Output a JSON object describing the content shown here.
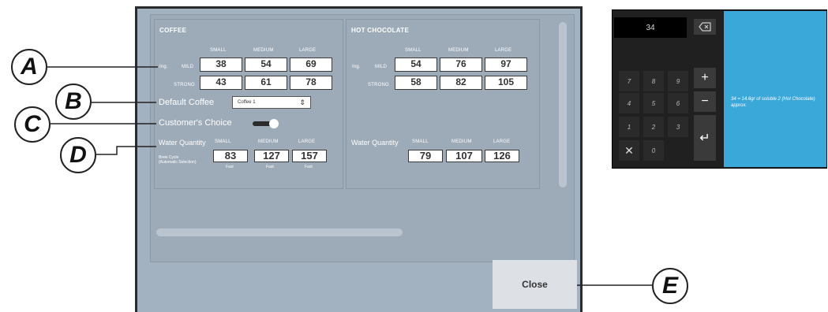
{
  "colors": {
    "panel": "#a3b2c0",
    "accent_blue": "#3aa8d8",
    "keypad_bg": "#202020"
  },
  "coffee": {
    "title": "COFFEE",
    "sizes": [
      "SMALL",
      "MEDIUM",
      "LARGE"
    ],
    "ing_label": "Ing.",
    "mild_label": "MILD",
    "strong_label": "STRONG",
    "mild": [
      "38",
      "54",
      "69"
    ],
    "strong": [
      "43",
      "61",
      "78"
    ],
    "default_label": "Default Coffee",
    "default_value": "Coffee 1",
    "customer_choice_label": "Customer's Choice",
    "customer_choice_on": true,
    "water_label": "Water Quantity",
    "water": [
      "83",
      "127",
      "157"
    ],
    "brew_label": "Brew Cycle\n(Automatic Selection)",
    "brew": [
      "Fast",
      "Fast",
      "Fast"
    ]
  },
  "hot_chocolate": {
    "title": "HOT CHOCOLATE",
    "sizes": [
      "SMALL",
      "MEDIUM",
      "LARGE"
    ],
    "ing_label": "Ing.",
    "mild_label": "MILD",
    "strong_label": "STRONG",
    "mild": [
      "54",
      "76",
      "97"
    ],
    "strong": [
      "58",
      "82",
      "105"
    ],
    "water_label": "Water Quantity",
    "water": [
      "79",
      "107",
      "126"
    ]
  },
  "close_label": "Close",
  "callouts": [
    "A",
    "B",
    "C",
    "D",
    "E"
  ],
  "keypad": {
    "display": "34",
    "keys": [
      "7",
      "8",
      "9",
      "4",
      "5",
      "6",
      "1",
      "2",
      "3",
      "0"
    ],
    "message": "34 = 14.6gr of soluble 2 (Hot Chocolate) approx."
  }
}
